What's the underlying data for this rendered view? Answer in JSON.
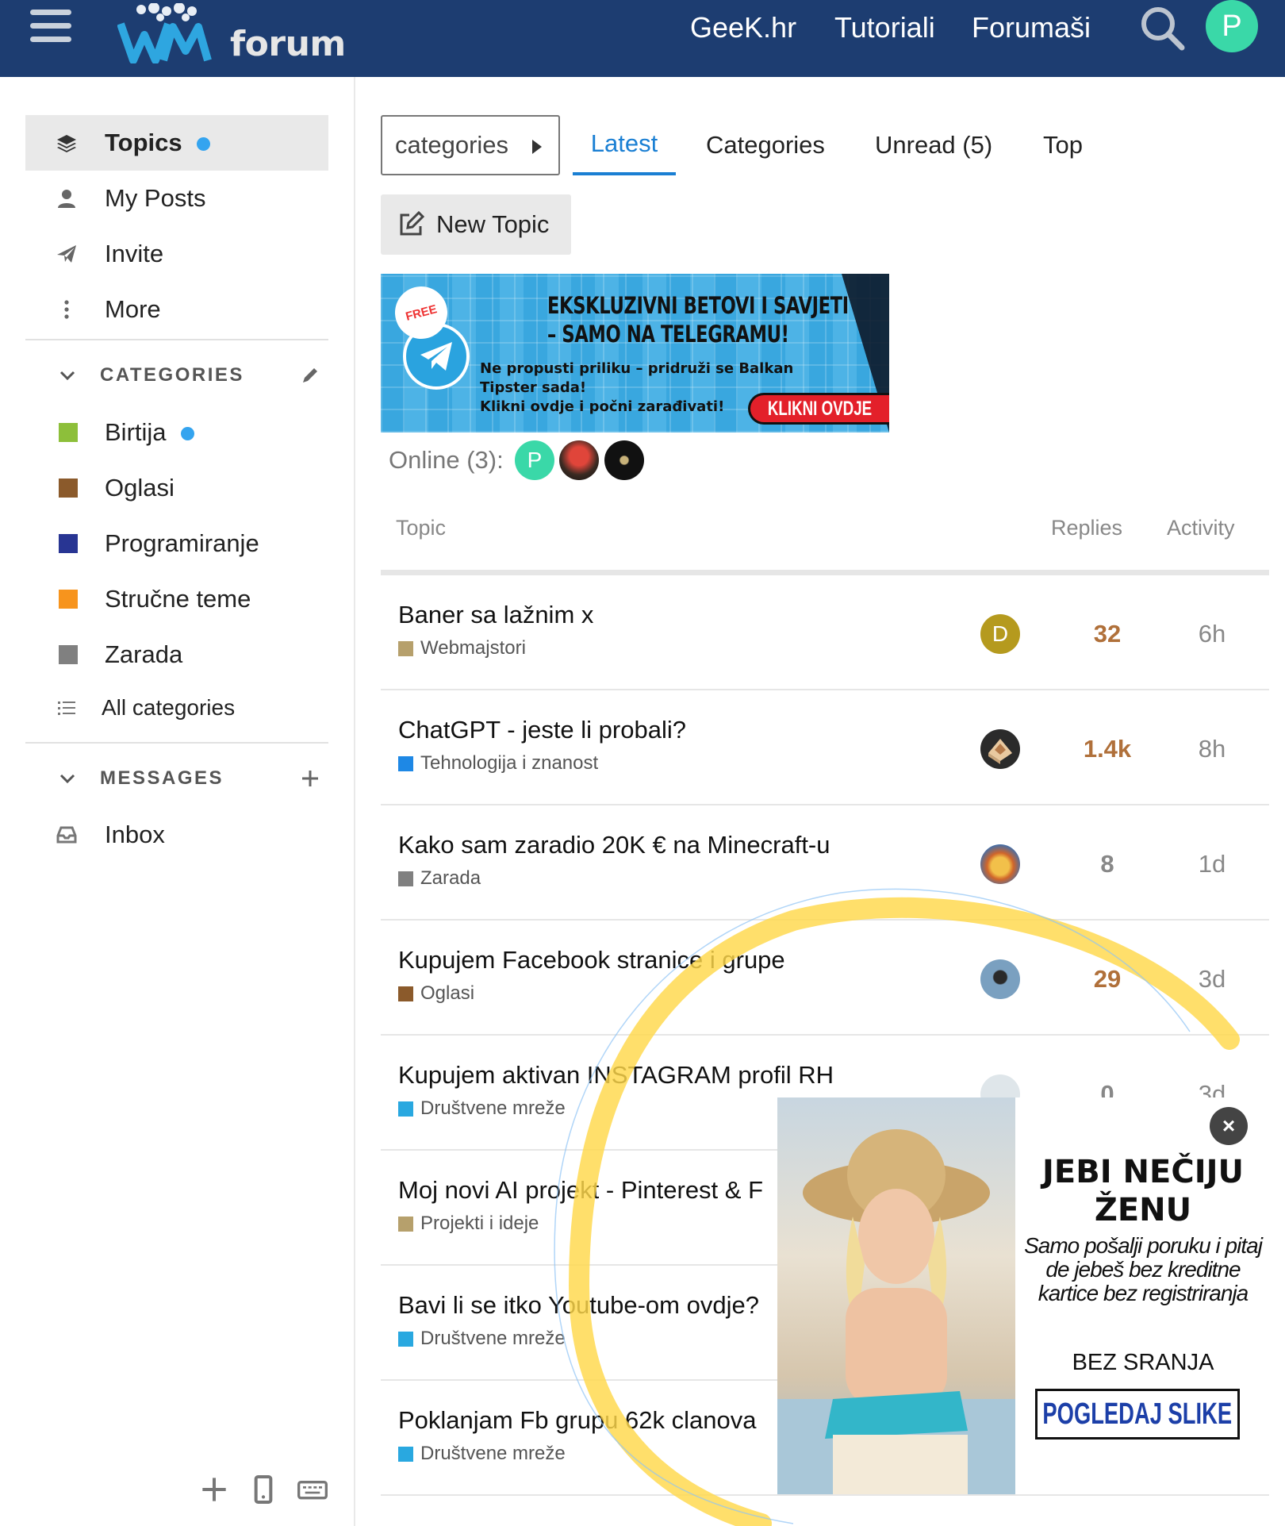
{
  "header": {
    "logo_text": "forum",
    "links": [
      "GeeK.hr",
      "Tutoriali",
      "Forumaši"
    ],
    "avatar_letter": "P",
    "colors": {
      "bg": "#1d3d71",
      "avatar": "#3ad8a8"
    }
  },
  "sidebar": {
    "items": [
      {
        "label": "Topics",
        "icon": "layers-icon",
        "active": true
      },
      {
        "label": "My Posts",
        "icon": "user-icon"
      },
      {
        "label": "Invite",
        "icon": "paper-plane-icon"
      },
      {
        "label": "More",
        "icon": "ellipsis-vertical-icon"
      }
    ],
    "categories_title": "CATEGORIES",
    "categories": [
      {
        "label": "Birtija",
        "color": "#8dbf3a"
      },
      {
        "label": "Oglasi",
        "color": "#8b5a2b"
      },
      {
        "label": "Programiranje",
        "color": "#283593"
      },
      {
        "label": "Stručne teme",
        "color": "#f7941d"
      },
      {
        "label": "Zarada",
        "color": "#808080"
      }
    ],
    "all_categories": "All categories",
    "messages_title": "MESSAGES",
    "inbox": "Inbox"
  },
  "main": {
    "dropdown_label": "categories",
    "tabs": [
      "Latest",
      "Categories",
      "Unread (5)",
      "Top"
    ],
    "new_topic": "New Topic",
    "banner": {
      "free": "FREE",
      "title_1": "EKSKLUZIVNI BETOVI I SAVJETI",
      "title_2": "– SAMO NA TELEGRAMU!",
      "sub": "Ne propusti priliku – pridruži se Balkan\nTipster sada!\nKlikni ovdje i počni zarađivati!",
      "button": "KLIKNI OVDJE"
    },
    "online_label": "Online (3):",
    "online_avatar_letter": "P",
    "columns": {
      "topic": "Topic",
      "replies": "Replies",
      "activity": "Activity"
    },
    "topics": [
      {
        "title": "Baner sa lažnim x",
        "category": "Webmajstori",
        "cat_color": "#b6a06c",
        "replies": "32",
        "replies_color": "#b0703a",
        "activity": "6h",
        "avatar_letter": "D",
        "avatar_color": "#b59a1e"
      },
      {
        "title": "ChatGPT - jeste li probali?",
        "category": "Tehnologija i znanost",
        "cat_color": "#1e88e5",
        "replies": "1.4k",
        "replies_color": "#b0703a",
        "activity": "8h"
      },
      {
        "title": "Kako sam zaradio 20K € na Minecraft-u",
        "category": "Zarada",
        "cat_color": "#808080",
        "replies": "8",
        "replies_color": "#888888",
        "activity": "1d"
      },
      {
        "title": "Kupujem Facebook stranice i grupe",
        "category": "Oglasi",
        "cat_color": "#8b5a2b",
        "replies": "29",
        "replies_color": "#b0703a",
        "activity": "3d"
      },
      {
        "title": "Kupujem aktivan INSTAGRAM profil RH",
        "category": "Društvene mreže",
        "cat_color": "#29a8e0",
        "replies": "0",
        "replies_color": "#888888",
        "activity": "3d"
      },
      {
        "title": "Moj novi AI projekt - Pinterest & F",
        "category": "Projekti i ideje",
        "cat_color": "#b6a06c",
        "replies": "",
        "activity": ""
      },
      {
        "title": "Bavi li se itko Youtube-om ovdje?",
        "category": "Društvene mreže",
        "cat_color": "#29a8e0",
        "replies": "",
        "activity": ""
      },
      {
        "title": "Poklanjam Fb grupu 62k clanova",
        "category": "Društvene mreže",
        "cat_color": "#29a8e0",
        "replies": "",
        "activity": ""
      }
    ]
  },
  "ad": {
    "close": "×",
    "headline": "JEBI NEČIJU ŽENU",
    "copy": "Samo pošalji poruku i pitaj de jebeš bez kreditne kartice bez registriranja",
    "strong": "BEZ SRANJA",
    "cta": "POGLEDAJ SLIKE"
  }
}
